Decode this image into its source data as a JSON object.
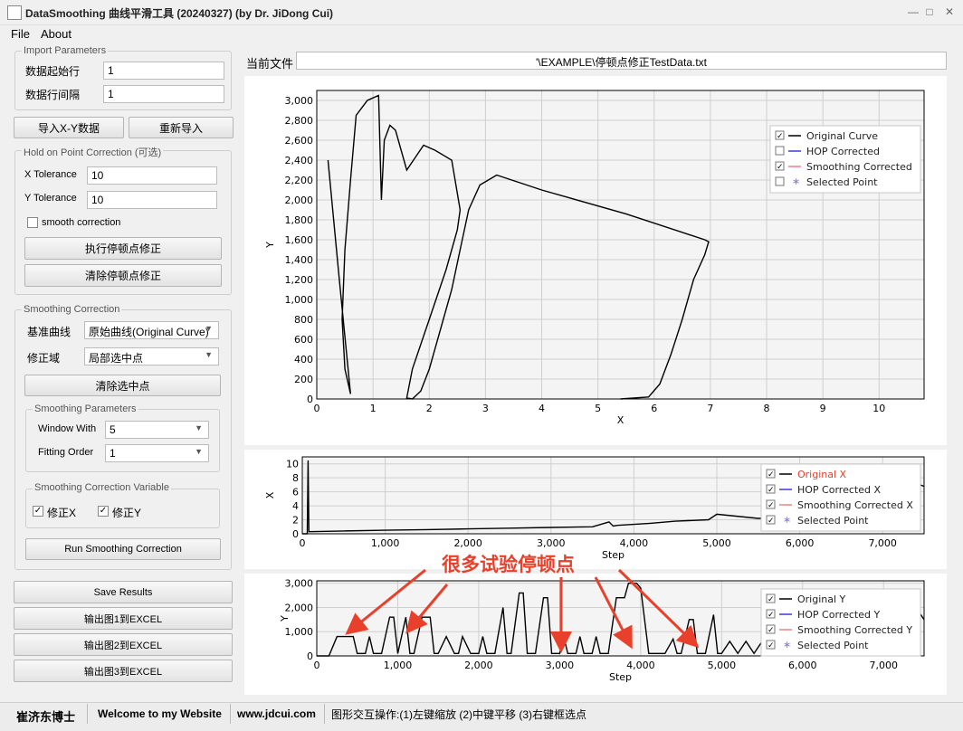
{
  "window": {
    "title": "DataSmoothing 曲线平滑工具 (20240327) (by Dr. JiDong Cui)",
    "minimize": "—",
    "maximize": "□",
    "close": "✕"
  },
  "menu": [
    "File",
    "About"
  ],
  "import": {
    "group": "Import Parameters",
    "start_row_label": "数据起始行",
    "start_row_value": "1",
    "row_interval_label": "数据行间隔",
    "row_interval_value": "1"
  },
  "buttons": {
    "import_xy": "导入X-Y数据",
    "reimport": "重新导入",
    "run_hop": "执行停顿点修正",
    "clear_hop": "清除停顿点修正",
    "clear_selected": "清除选中点",
    "run_smoothing": "Run Smoothing Correction",
    "save_results": "Save Results",
    "export1": "输出图1到EXCEL",
    "export2": "输出图2到EXCEL",
    "export3": "输出图3到EXCEL"
  },
  "hop": {
    "group": "Hold on Point Correction (可选)",
    "x_tol_label": "X Tolerance",
    "x_tol_value": "10",
    "y_tol_label": "Y Tolerance",
    "y_tol_value": "10",
    "smooth_label": "smooth correction",
    "smooth_checked": false
  },
  "smoothing": {
    "group": "Smoothing Correction",
    "base_label": "基准曲线",
    "base_value": "原始曲线(Original Curve)",
    "domain_label": "修正域",
    "domain_value": "局部选中点",
    "params_group": "Smoothing Parameters",
    "window_label": "Window With",
    "window_value": "5",
    "order_label": "Fitting Order",
    "order_value": "1",
    "var_group": "Smoothing Correction Variable",
    "fix_x": "修正X",
    "fix_y": "修正Y",
    "fix_x_checked": true,
    "fix_y_checked": true
  },
  "file": {
    "label": "当前文件",
    "path": "'\\EXAMPLE\\停顿点修正TestData.txt"
  },
  "annotation": "很多试验停顿点",
  "status": {
    "author": "崔济东博士",
    "welcome": "Welcome to my Website",
    "site": "www.jdcui.com",
    "hint": "图形交互操作:(1)左键缩放 (2)中键平移 (3)右键框选点"
  },
  "colors": {
    "original": "#000000",
    "hop": "#3b3bd6",
    "smoothing": "#f08080",
    "selected": "#7a7aff",
    "arrow": "#e8402a"
  },
  "chart_data": [
    {
      "type": "line",
      "xlabel": "X",
      "ylabel": "Y",
      "xlim": [
        0,
        10.8
      ],
      "ylim": [
        0,
        3100
      ],
      "xticks": [
        "0",
        "1",
        "2",
        "3",
        "4",
        "5",
        "6",
        "7",
        "8",
        "9",
        "10"
      ],
      "yticks": [
        "0",
        "200",
        "400",
        "600",
        "800",
        "1,000",
        "1,200",
        "1,400",
        "1,600",
        "1,800",
        "2,000",
        "2,200",
        "2,400",
        "2,600",
        "2,800",
        "3,000"
      ],
      "legend": [
        {
          "name": "Original Curve",
          "checked": true
        },
        {
          "name": "HOP Corrected",
          "checked": false
        },
        {
          "name": "Smoothing Corrected",
          "checked": true
        },
        {
          "name": "Selected Point",
          "checked": false
        }
      ],
      "series": [
        {
          "name": "Original Curve",
          "x": [
            5.4,
            5.9,
            6.1,
            6.3,
            6.5,
            6.7,
            6.9,
            6.97,
            6.9,
            5.5,
            4.0,
            3.2,
            2.9,
            2.7,
            2.55,
            2.4,
            2.2,
            2.0,
            1.85,
            1.7,
            1.6,
            1.7,
            2.0,
            2.3,
            2.5,
            2.55,
            2.4,
            2.1,
            1.9,
            1.6,
            1.4,
            1.3,
            1.2,
            1.15,
            1.1,
            0.9,
            0.7,
            0.6,
            0.5,
            0.45,
            0.5,
            0.6,
            0.4,
            0.2
          ],
          "y": [
            0,
            20,
            150,
            450,
            800,
            1200,
            1450,
            1580,
            1600,
            1860,
            2100,
            2250,
            2150,
            1900,
            1500,
            1100,
            700,
            300,
            80,
            0,
            10,
            300,
            800,
            1300,
            1700,
            1900,
            2400,
            2500,
            2550,
            2300,
            2700,
            2750,
            2600,
            2000,
            3050,
            3000,
            2850,
            2200,
            1500,
            800,
            300,
            50,
            1200,
            2400
          ]
        }
      ]
    },
    {
      "type": "line",
      "xlabel": "Step",
      "ylabel": "X",
      "xlim": [
        0,
        7500
      ],
      "ylim": [
        0,
        11
      ],
      "xticks": [
        "0",
        "1,000",
        "2,000",
        "3,000",
        "4,000",
        "5,000",
        "6,000",
        "7,000"
      ],
      "yticks": [
        "0",
        "2",
        "4",
        "6",
        "8",
        "10"
      ],
      "legend": [
        {
          "name": "Original X",
          "checked": true
        },
        {
          "name": "HOP Corrected X",
          "checked": true
        },
        {
          "name": "Smoothing Corrected X",
          "checked": true
        },
        {
          "name": "Selected Point",
          "checked": true
        }
      ],
      "series": [
        {
          "name": "Original X",
          "x": [
            0,
            60,
            70,
            80,
            500,
            1000,
            1500,
            2000,
            2500,
            3000,
            3500,
            3700,
            3750,
            3800,
            4200,
            4500,
            4900,
            5000,
            5500,
            6000,
            6500,
            7000,
            7300,
            7400,
            7450,
            7500
          ],
          "y": [
            0,
            0,
            10.5,
            0.3,
            0.4,
            0.5,
            0.6,
            0.7,
            0.8,
            0.9,
            1.0,
            1.7,
            1.1,
            1.2,
            1.5,
            1.8,
            2.0,
            2.8,
            2.2,
            2.4,
            2.6,
            3.0,
            6.5,
            3.2,
            7.0,
            6.8
          ]
        }
      ]
    },
    {
      "type": "line",
      "xlabel": "Step",
      "ylabel": "Y",
      "xlim": [
        0,
        7500
      ],
      "ylim": [
        0,
        3100
      ],
      "xticks": [
        "0",
        "1,000",
        "2,000",
        "3,000",
        "4,000",
        "5,000",
        "6,000",
        "7,000"
      ],
      "yticks": [
        "0",
        "1,000",
        "2,000",
        "3,000"
      ],
      "legend": [
        {
          "name": "Original Y",
          "checked": true
        },
        {
          "name": "HOP Corrected Y",
          "checked": true
        },
        {
          "name": "Smoothing Corrected Y",
          "checked": true
        },
        {
          "name": "Selected Point",
          "checked": true
        }
      ],
      "series": [
        {
          "name": "Original Y",
          "x": [
            0,
            150,
            250,
            450,
            500,
            600,
            650,
            700,
            800,
            900,
            950,
            1000,
            1100,
            1150,
            1200,
            1300,
            1400,
            1450,
            1500,
            1600,
            1700,
            1750,
            1800,
            1900,
            2000,
            2050,
            2100,
            2200,
            2300,
            2350,
            2400,
            2500,
            2550,
            2600,
            2700,
            2800,
            2850,
            2900,
            3000,
            3050,
            3100,
            3200,
            3250,
            3300,
            3400,
            3450,
            3500,
            3600,
            3700,
            3800,
            3850,
            3950,
            4000,
            4100,
            4200,
            4300,
            4400,
            4450,
            4500,
            4600,
            4650,
            4700,
            4800,
            4900,
            4950,
            5000,
            5100,
            5200,
            5300,
            5400,
            5500,
            5600,
            5700,
            5800,
            5900,
            6000,
            6100,
            6200,
            6300,
            6400,
            6500,
            6600,
            6700,
            6800,
            6900,
            7000,
            7100,
            7200,
            7300,
            7400,
            7500
          ],
          "y": [
            0,
            0,
            800,
            800,
            100,
            100,
            800,
            100,
            100,
            1600,
            1600,
            100,
            1600,
            100,
            100,
            1600,
            1600,
            100,
            100,
            800,
            100,
            100,
            800,
            100,
            100,
            800,
            100,
            100,
            2000,
            100,
            100,
            2600,
            2600,
            100,
            100,
            2400,
            2400,
            100,
            100,
            800,
            100,
            100,
            800,
            100,
            100,
            800,
            100,
            100,
            2400,
            2400,
            3000,
            3000,
            2800,
            100,
            100,
            100,
            700,
            100,
            100,
            1500,
            1500,
            100,
            100,
            1700,
            100,
            100,
            600,
            100,
            600,
            100,
            600,
            100,
            1200,
            100,
            1200,
            100,
            1200,
            100,
            600,
            100,
            1200,
            100,
            1200,
            100,
            600,
            100,
            1500,
            100,
            1200,
            2000,
            1500
          ]
        }
      ]
    }
  ]
}
